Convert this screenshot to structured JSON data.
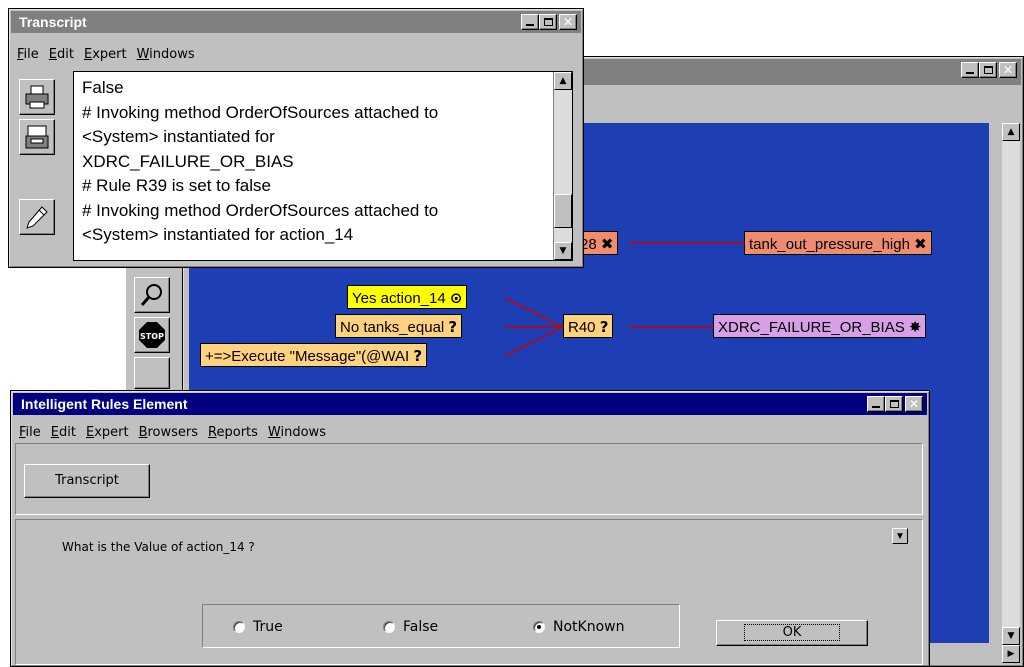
{
  "transcript_window": {
    "title": "Transcript",
    "menu": [
      "File",
      "Edit",
      "Expert",
      "Windows"
    ],
    "lines": [
      "False",
      "# Invoking method OrderOfSources attached to",
      "<System> instantiated for",
      "XDRC_FAILURE_OR_BIAS",
      "# Rule R39 is set to false",
      "# Invoking method OrderOfSources attached to",
      "<System> instantiated for action_14"
    ],
    "side_icons": [
      "print-icon",
      "save-icon",
      "edit-pencil-icon"
    ]
  },
  "graph_window": {
    "title": "",
    "nodes": {
      "r28": "28",
      "tank": "tank_out_pressure_high",
      "yes_action": "Yes action_14",
      "no_tanks": "No tanks_equal",
      "execute": "+=>Execute \"Message\"(@WAI",
      "r40": "R40",
      "xdrc": "XDRC_FAILURE_OR_BIAS"
    },
    "colors": {
      "canvas": "#1e3fb4",
      "link": "#cc0000"
    },
    "tools": [
      "magnifier-icon",
      "stop-icon"
    ],
    "stop_label": "STOP"
  },
  "ire_window": {
    "title": "Intelligent Rules Element",
    "menu": [
      "File",
      "Edit",
      "Expert",
      "Browsers",
      "Reports",
      "Windows"
    ],
    "transcript_button": "Transcript",
    "question": "What is the Value of action_14 ?",
    "options": [
      {
        "label": "True",
        "selected": false
      },
      {
        "label": "False",
        "selected": false
      },
      {
        "label": "NotKnown",
        "selected": true
      }
    ],
    "ok_button": "OK"
  }
}
